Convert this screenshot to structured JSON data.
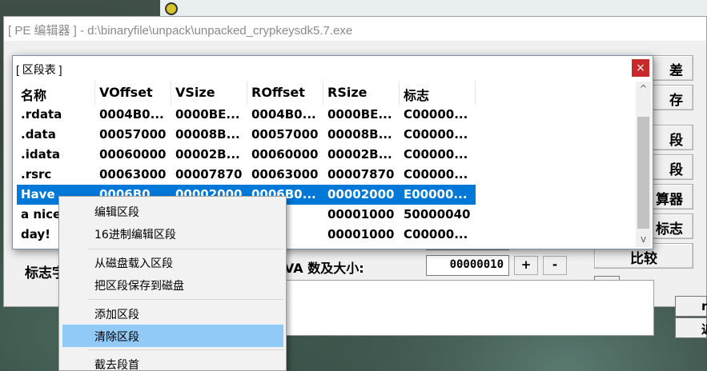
{
  "pe_editor": {
    "title": "[ PE 编辑器 ] - d:\\binaryfile\\unpack\\unpacked_crypkeysdk5.7.exe",
    "right_buttons": [
      "差",
      "存",
      "段",
      "段",
      "算器",
      "标志",
      "比较"
    ],
    "l_button": "L",
    "flag_label": "标志字",
    "rva_label": "VA 数及大小:",
    "rva_value": "00000010",
    "plus": "+",
    "minus": "-",
    "edge_buttons": [
      "r",
      "近"
    ]
  },
  "section_dialog": {
    "title": "[ 区段表 ]",
    "close_glyph": "×",
    "columns": [
      "名称",
      "VOffset",
      "VSize",
      "ROffset",
      "RSize",
      "标志"
    ],
    "rows": [
      [
        ".rdata",
        "0004B0...",
        "0000BE...",
        "0004B0...",
        "0000BE...",
        "C00000..."
      ],
      [
        ".data",
        "00057000",
        "00008B...",
        "00057000",
        "00008B...",
        "C00000..."
      ],
      [
        ".idata",
        "00060000",
        "00002B...",
        "00060000",
        "00002B...",
        "C00000..."
      ],
      [
        ".rsrc",
        "00063000",
        "00007870",
        "00063000",
        "00007870",
        "C00000..."
      ],
      [
        "Have",
        "0006B0...",
        "00002000",
        "0006B0...",
        "00002000",
        "E00000..."
      ],
      [
        "a nice",
        "",
        "",
        "D0...",
        "00001000",
        "50000040"
      ],
      [
        "day!",
        "",
        "",
        "E0...",
        "00001000",
        "C00000..."
      ]
    ],
    "selected_row": 4,
    "scroll_up": "^",
    "scroll_down": "v"
  },
  "context_menu": {
    "items": [
      "编辑区段",
      "16进制编辑区段",
      "从磁盘载入区段",
      "把区段保存到磁盘",
      "添加区段",
      "清除区段",
      "截去段首"
    ],
    "highlighted_index": 5
  }
}
